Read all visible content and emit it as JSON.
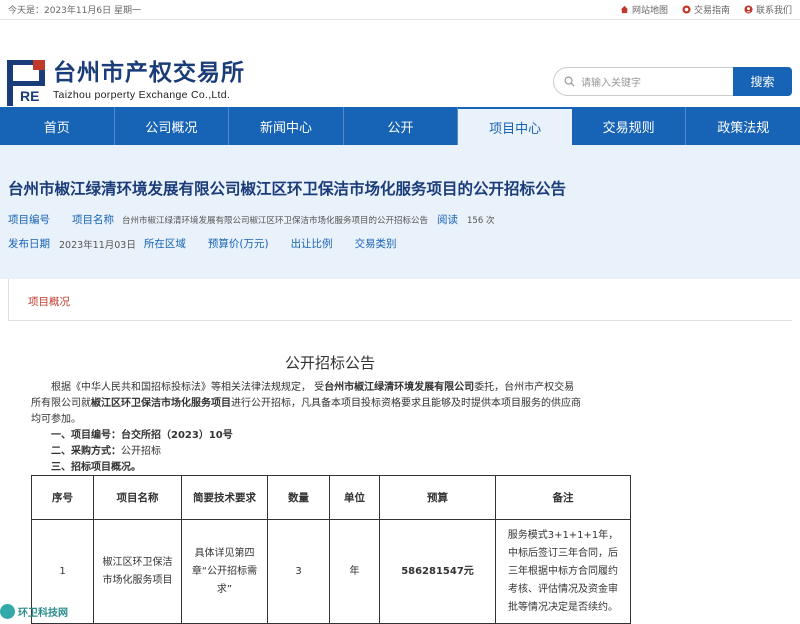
{
  "topbar": {
    "date": "今天是：2023年11月6日 星期一",
    "links": [
      {
        "label": "网站地图",
        "icon": "home-icon"
      },
      {
        "label": "交易指南",
        "icon": "guide-icon"
      },
      {
        "label": "联系我们",
        "icon": "contact-icon"
      }
    ]
  },
  "logo": {
    "mark": "RE",
    "cn": "台州市产权交易所",
    "en": "Taizhou porperty Exchange Co.,Ltd."
  },
  "search": {
    "placeholder": "请输入关键字",
    "button": "搜索"
  },
  "nav": [
    "首页",
    "公司概况",
    "新闻中心",
    "公开",
    "项目中心",
    "交易规则",
    "政策法规"
  ],
  "nav_active": 4,
  "project": {
    "title": "台州市椒江绿清环境发展有限公司椒江区环卫保洁市场化服务项目的公开招标公告",
    "number_label": "项目编号",
    "name_label": "项目名称",
    "name_value": "台州市椒江绿清环境发展有限公司椒江区环卫保洁市场化服务项目的公开招标公告",
    "views_label": "阅读",
    "views_value": "156 次",
    "date_label": "发布日期",
    "date_value": "2023年11月03日",
    "region_label": "所在区域",
    "price_label": "预算价(万元)",
    "ratio_label": "出让比例",
    "type_label": "交易类别"
  },
  "tab": "项目概况",
  "doc": {
    "title": "公开招标公告",
    "p1_a": "根据《中华人民共和国招标投标法》等相关法律法规规定，   受",
    "p1_b": "台州市椒江绿清环境发展有限公司",
    "p1_c": "委托，台州市产权交易",
    "p2_a": "所有限公司就",
    "p2_b": "椒江区环卫保洁市场化服务项目",
    "p2_c": "进行公开招标，凡具备本项目投标资格要求且能够及时提供本项目服务的供应商",
    "p3": "均可参加。",
    "item1_label": "一、项目编号：",
    "item1_value": "台交所招（2023）10号",
    "item2_label": "二、采购方式：",
    "item2_value": "公开招标",
    "item3_label": "三、招标项目概况。"
  },
  "table": {
    "headers": [
      "序号",
      "项目名称",
      "简要技术要求",
      "数量",
      "单位",
      "预算",
      "备注"
    ],
    "row": {
      "no": "1",
      "name": "椒江区环卫保洁市场化服务项目",
      "req": "具体详见第四章“公开招标需求”",
      "qty": "3",
      "unit": "年",
      "budget": "586281547元",
      "note": "服务模式3+1+1+1年，中标后签订三年合同，后三年根据中标方合同履约考核、评估情况及资金审批等情况决定是否续约。"
    }
  },
  "watermark": "环卫科技网",
  "colors": {
    "brand": "#1763b5",
    "dark": "#1a3c78",
    "accent": "#c0392b",
    "panel": "#e9f1fa"
  }
}
